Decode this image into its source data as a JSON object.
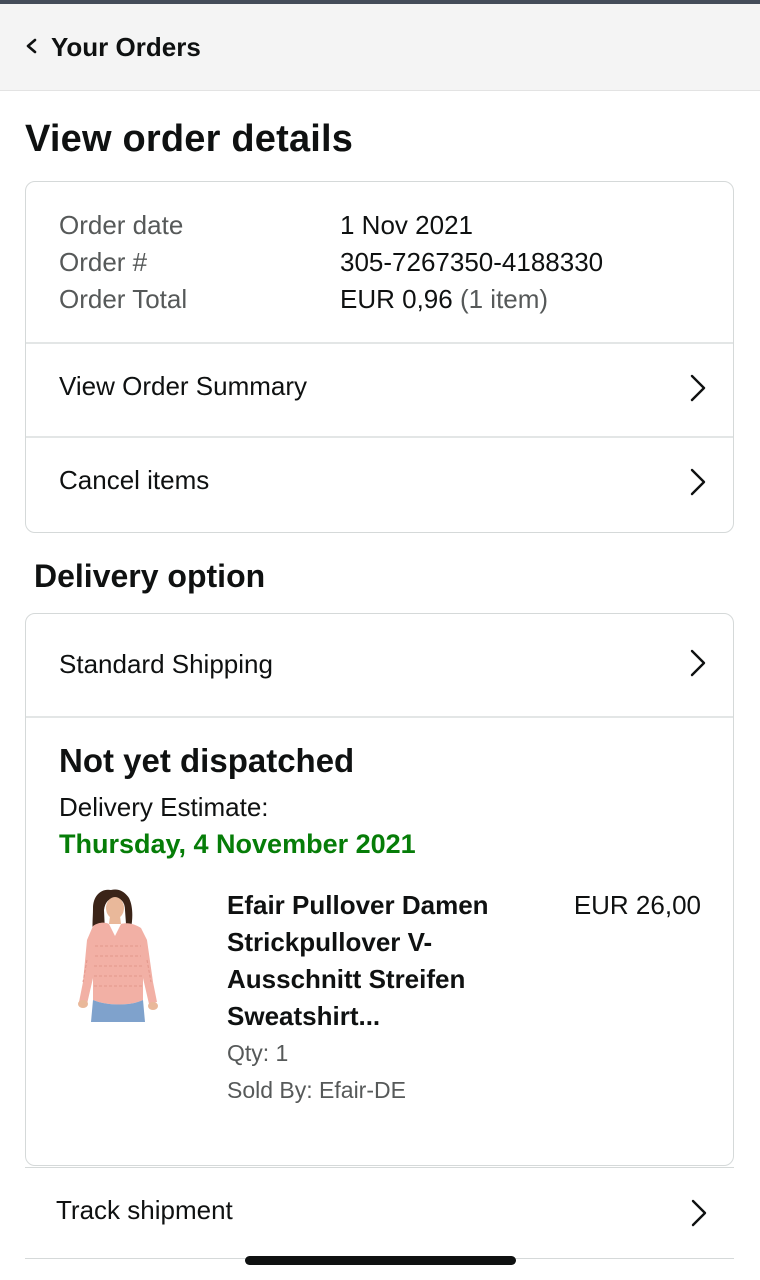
{
  "nav": {
    "back_label": "Your Orders"
  },
  "page_title": "View order details",
  "order": {
    "date_label": "Order date",
    "date_value": "1 Nov 2021",
    "number_label": "Order #",
    "number_value": "305-7267350-4188330",
    "total_label": "Order Total",
    "total_value": "EUR 0,96",
    "total_items": "(1 item)",
    "summary_link": "View Order Summary",
    "cancel_link": "Cancel items"
  },
  "delivery": {
    "section_title": "Delivery option",
    "shipping_method": "Standard Shipping",
    "status": "Not yet dispatched",
    "estimate_label": "Delivery Estimate:",
    "estimate_date": "Thursday, 4 November 2021",
    "estimate_color": "#067d08",
    "item": {
      "title_line1": "Efair Pullover Damen",
      "title_line2": "Strickpullover V-",
      "title_line3": "Ausschnitt Streifen",
      "title_line4": "Sweatshirt...",
      "price": "EUR 26,00",
      "qty": "Qty: 1",
      "sold_by": "Sold By: Efair-DE"
    }
  },
  "track": {
    "label": "Track shipment"
  },
  "icons": {
    "back": "chevron-left-icon",
    "row": "chevron-right-icon"
  }
}
